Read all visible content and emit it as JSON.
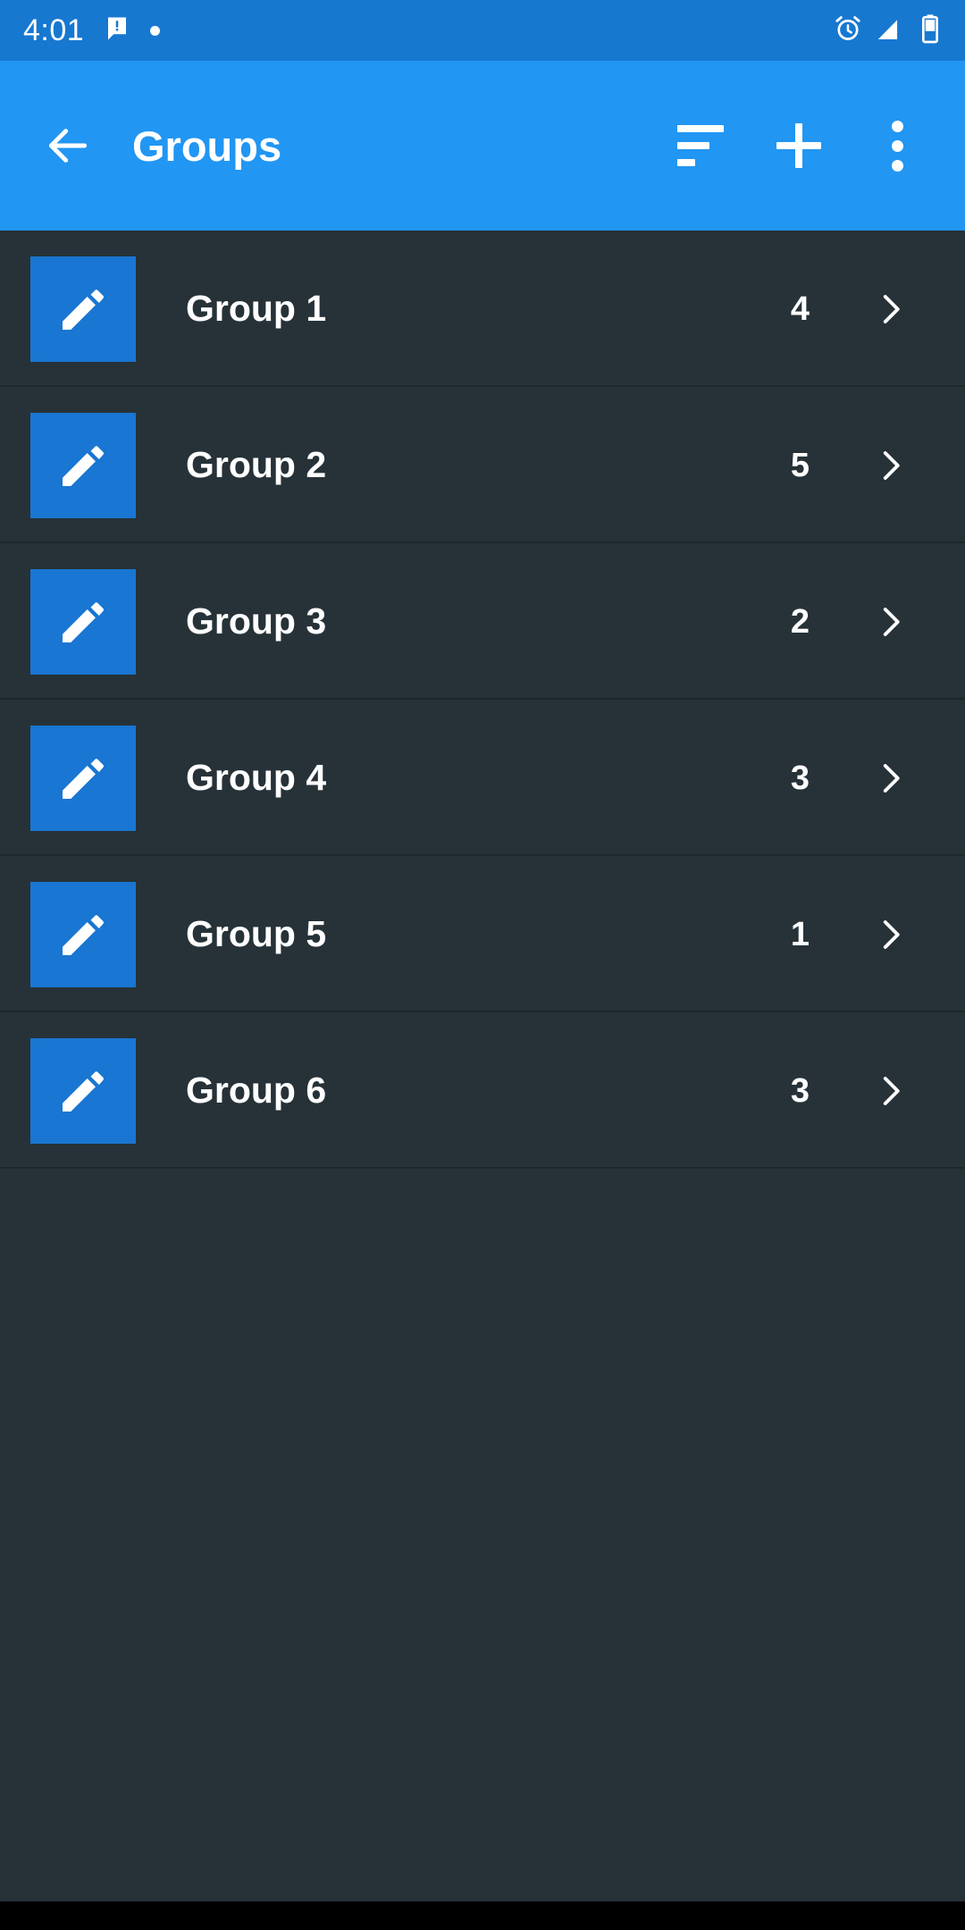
{
  "status_bar": {
    "time": "4:01",
    "background_color": "#1778D0",
    "left_icons": [
      "message-icon",
      "notification-dot"
    ],
    "right_icons": [
      "alarm-icon",
      "signal-no-service-icon",
      "battery-icon"
    ]
  },
  "app_bar": {
    "title": "Groups",
    "background_color": "#2196F3",
    "back_icon": "arrow-left-icon",
    "actions": [
      {
        "name": "sort",
        "icon": "sort-icon"
      },
      {
        "name": "add",
        "icon": "plus-icon"
      },
      {
        "name": "more",
        "icon": "overflow-menu-icon"
      }
    ]
  },
  "list": {
    "background_color": "#263238",
    "thumbnail_color": "#1976D2",
    "thumbnail_icon": "pencil-icon",
    "chevron_icon": "chevron-right-icon",
    "rows": [
      {
        "label": "Group 1",
        "count": "4"
      },
      {
        "label": "Group 2",
        "count": "5"
      },
      {
        "label": "Group 3",
        "count": "2"
      },
      {
        "label": "Group 4",
        "count": "3"
      },
      {
        "label": "Group 5",
        "count": "1"
      },
      {
        "label": "Group 6",
        "count": "3"
      }
    ]
  }
}
